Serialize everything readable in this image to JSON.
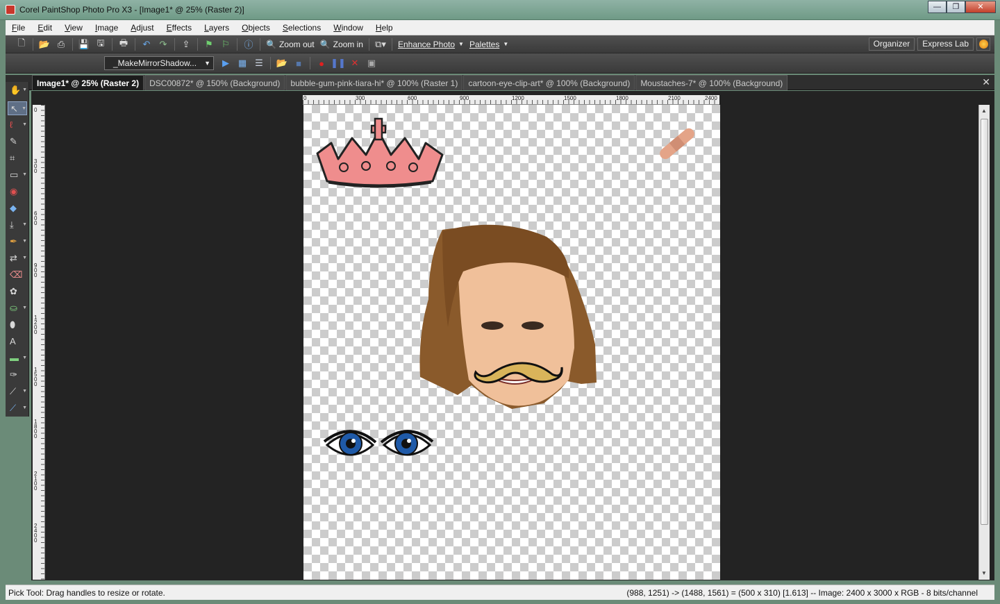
{
  "window": {
    "title": "Corel PaintShop Photo Pro X3 - [Image1* @  25% (Raster 2)]",
    "minimize_label": "—",
    "restore_label": "❐",
    "close_label": "✕"
  },
  "menu": [
    "File",
    "Edit",
    "View",
    "Image",
    "Adjust",
    "Effects",
    "Layers",
    "Objects",
    "Selections",
    "Window",
    "Help"
  ],
  "toolbar": {
    "zoom_out": "Zoom out",
    "zoom_in": "Zoom in",
    "enhance_photo": "Enhance Photo",
    "palettes": "Palettes",
    "organizer": "Organizer",
    "express_lab": "Express Lab",
    "script_name": "_MakeMirrorShadow..."
  },
  "tabs": [
    "Image1* @  25% (Raster 2)",
    "DSC00872* @ 150% (Background)",
    "bubble-gum-pink-tiara-hi* @ 100% (Raster 1)",
    "cartoon-eye-clip-art* @ 100% (Background)",
    "Moustaches-7* @ 100% (Background)"
  ],
  "ruler": {
    "h_labels": [
      "0",
      "300",
      "600",
      "900",
      "1200",
      "1500",
      "1800",
      "2100",
      "2400"
    ],
    "v_labels": [
      "0",
      "300",
      "600",
      "900",
      "1200",
      "1500",
      "1800",
      "2100",
      "2400"
    ]
  },
  "status": {
    "tool_hint": "Pick Tool: Drag handles to resize or rotate.",
    "info": "(988, 1251) -> (1488, 1561) = (500 x 310) [1.613] -- Image:  2400 x 3000 x RGB - 8 bits/channel"
  },
  "colors": {
    "tiara": "#e88a8a",
    "mustache": "#d9b45a",
    "iris": "#1f5aa8",
    "hair": "#8a5a2b",
    "skin": "#f0c09a",
    "bandage": "#e4a488"
  }
}
